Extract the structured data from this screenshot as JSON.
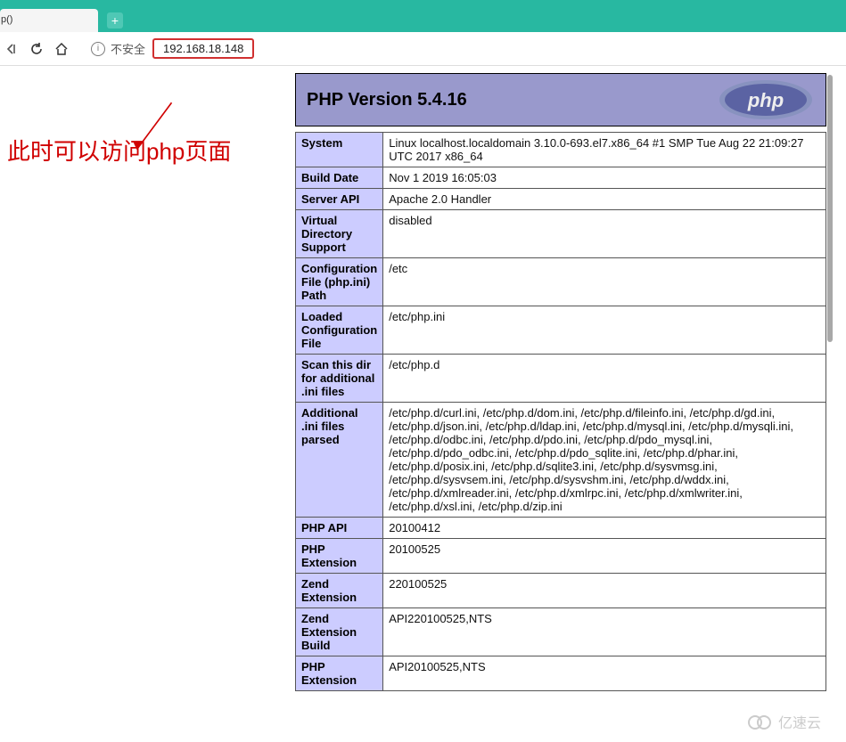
{
  "browser": {
    "tab_label": "p()",
    "new_tab_glyph": "+",
    "security_label": "不安全",
    "url": "192.168.18.148"
  },
  "annotation": "此时可以访问php页面",
  "php": {
    "header_title": "PHP Version 5.4.16",
    "logo_alt": "php",
    "rows": [
      {
        "key": "System",
        "val": "Linux localhost.localdomain 3.10.0-693.el7.x86_64 #1 SMP Tue Aug 22 21:09:27 UTC 2017 x86_64"
      },
      {
        "key": "Build Date",
        "val": "Nov 1 2019 16:05:03"
      },
      {
        "key": "Server API",
        "val": "Apache 2.0 Handler"
      },
      {
        "key": "Virtual Directory Support",
        "val": "disabled"
      },
      {
        "key": "Configuration File (php.ini) Path",
        "val": "/etc"
      },
      {
        "key": "Loaded Configuration File",
        "val": "/etc/php.ini"
      },
      {
        "key": "Scan this dir for additional .ini files",
        "val": "/etc/php.d"
      },
      {
        "key": "Additional .ini files parsed",
        "val": "/etc/php.d/curl.ini, /etc/php.d/dom.ini, /etc/php.d/fileinfo.ini, /etc/php.d/gd.ini, /etc/php.d/json.ini, /etc/php.d/ldap.ini, /etc/php.d/mysql.ini, /etc/php.d/mysqli.ini, /etc/php.d/odbc.ini, /etc/php.d/pdo.ini, /etc/php.d/pdo_mysql.ini, /etc/php.d/pdo_odbc.ini, /etc/php.d/pdo_sqlite.ini, /etc/php.d/phar.ini, /etc/php.d/posix.ini, /etc/php.d/sqlite3.ini, /etc/php.d/sysvmsg.ini, /etc/php.d/sysvsem.ini, /etc/php.d/sysvshm.ini, /etc/php.d/wddx.ini, /etc/php.d/xmlreader.ini, /etc/php.d/xmlrpc.ini, /etc/php.d/xmlwriter.ini, /etc/php.d/xsl.ini, /etc/php.d/zip.ini"
      },
      {
        "key": "PHP API",
        "val": "20100412"
      },
      {
        "key": "PHP Extension",
        "val": "20100525"
      },
      {
        "key": "Zend Extension",
        "val": "220100525"
      },
      {
        "key": "Zend Extension Build",
        "val": "API220100525,NTS"
      },
      {
        "key": "PHP Extension",
        "val": "API20100525,NTS"
      }
    ]
  },
  "watermark": "亿速云"
}
